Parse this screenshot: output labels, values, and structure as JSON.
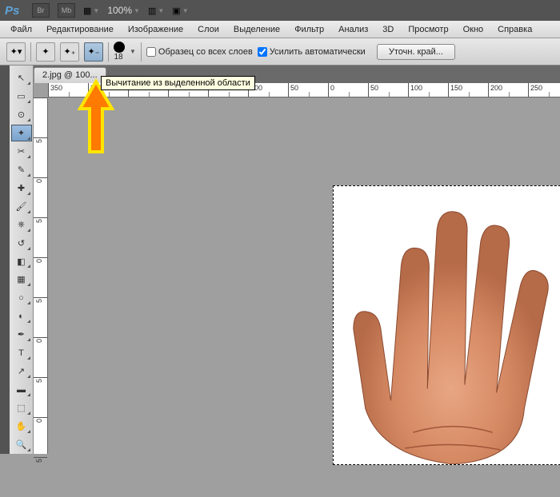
{
  "topbar": {
    "logo": "Ps",
    "br_label": "Br",
    "mb_label": "Mb",
    "zoom": "100%"
  },
  "menu": [
    "Файл",
    "Редактирование",
    "Изображение",
    "Слои",
    "Выделение",
    "Фильтр",
    "Анализ",
    "3D",
    "Просмотр",
    "Окно",
    "Справка"
  ],
  "options": {
    "brush_size": "18",
    "sample_all": "Образец со всех слоев",
    "auto_enhance": "Усилить автоматически",
    "refine": "Уточн. край...",
    "sample_all_checked": false,
    "auto_enhance_checked": true
  },
  "tab": {
    "title": "2.jpg @ 100..."
  },
  "tooltip": "Вычитание из выделенной области",
  "ruler_h": [
    "350",
    "300",
    "250",
    "200",
    "150",
    "100",
    "50",
    "0",
    "50",
    "100",
    "150",
    "200",
    "250"
  ],
  "ruler_v": [
    "",
    "5",
    "0",
    "5",
    "0",
    "5",
    "0",
    "5",
    "0",
    "5"
  ],
  "tools": [
    {
      "name": "move",
      "icon": "↖"
    },
    {
      "name": "marquee",
      "icon": "▭"
    },
    {
      "name": "lasso",
      "icon": "⊙"
    },
    {
      "name": "quick-select",
      "icon": "✦",
      "active": true
    },
    {
      "name": "crop",
      "icon": "✂"
    },
    {
      "name": "eyedropper",
      "icon": "✎"
    },
    {
      "name": "heal",
      "icon": "✚"
    },
    {
      "name": "brush",
      "icon": "🖌"
    },
    {
      "name": "stamp",
      "icon": "⎈"
    },
    {
      "name": "history-brush",
      "icon": "↺"
    },
    {
      "name": "eraser",
      "icon": "◧"
    },
    {
      "name": "gradient",
      "icon": "▦"
    },
    {
      "name": "blur",
      "icon": "○"
    },
    {
      "name": "dodge",
      "icon": "◐"
    },
    {
      "name": "pen",
      "icon": "✒"
    },
    {
      "name": "text",
      "icon": "T"
    },
    {
      "name": "path",
      "icon": "↗"
    },
    {
      "name": "shape",
      "icon": "▬"
    },
    {
      "name": "3d",
      "icon": "⬚"
    },
    {
      "name": "hand",
      "icon": "✋"
    },
    {
      "name": "zoom",
      "icon": "🔍"
    }
  ]
}
